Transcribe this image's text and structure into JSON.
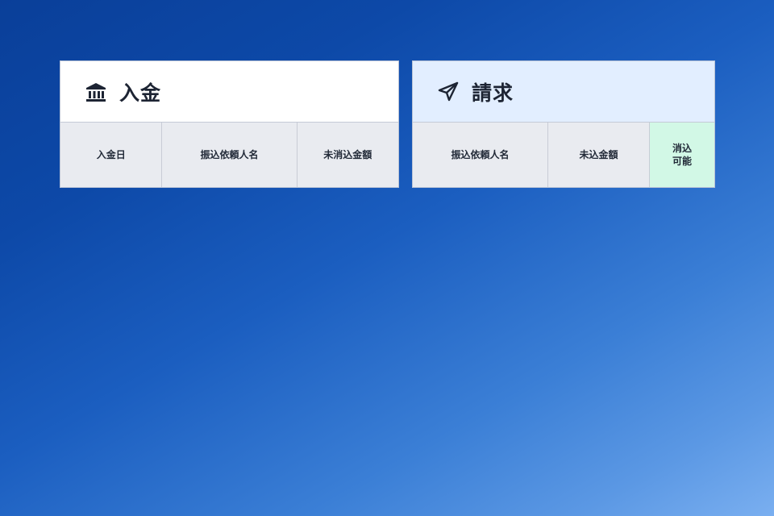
{
  "panels": {
    "deposit": {
      "title": "入金",
      "icon": "bank-icon",
      "header_bg": "#ffffff",
      "columns": [
        "入金日",
        "振込依頼人名",
        "未消込金額"
      ]
    },
    "invoice": {
      "title": "請求",
      "icon": "send-icon",
      "header_bg": "#e2eeff",
      "columns": [
        "振込依頼人名",
        "未込金額",
        "消込\n可能"
      ]
    }
  },
  "colors": {
    "header_text": "#1d2433",
    "column_bg": "#e9ebf0",
    "accent_column_bg": "#d2f8e6"
  }
}
